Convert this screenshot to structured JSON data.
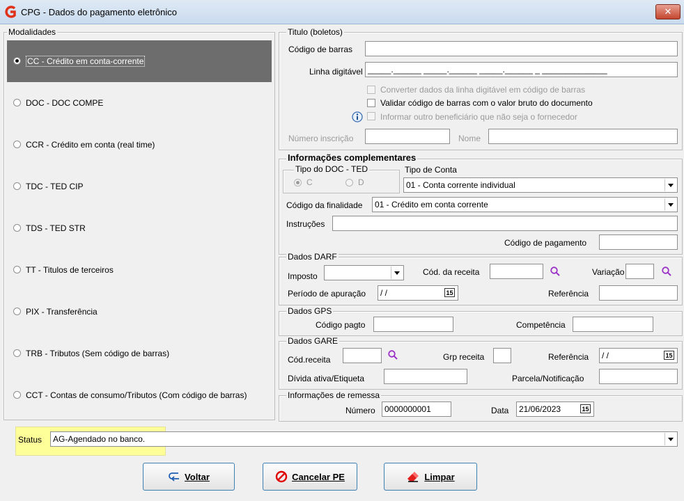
{
  "window": {
    "title": "CPG - Dados do pagamento eletrônico",
    "close_label": "✕"
  },
  "modalidades": {
    "legend": "Modalidades",
    "selected_index": 0,
    "items": [
      "CC  - Crédito em conta-corrente",
      "DOC - DOC COMPE",
      "CCR - Crédito em conta (real time)",
      "TDC - TED CIP",
      "TDS - TED STR",
      "TT  - Titulos de terceiros",
      "PIX - Transferência",
      "TRB - Tributos (Sem código de barras)",
      "CCT - Contas de consumo/Tributos (Com código de barras)"
    ]
  },
  "titulo": {
    "legend": "Titulo (boletos)",
    "codigo_barras_label": "Código de barras",
    "codigo_barras_value": "",
    "linha_digitavel_label": "Linha digitável",
    "linha_digitavel_value": "_____.______ _____.______ _____.______ _ ______________",
    "chk_converter": "Converter dados da linha digitável em código de barras",
    "chk_validar": "Validar código de barras com o valor bruto do documento",
    "chk_informar": "Informar outro beneficiário que não seja o fornecedor",
    "numero_inscricao_label": "Número inscrição",
    "nome_label": "Nome"
  },
  "info_compl": {
    "legend": "Informações complementares",
    "tipo_doc_legend": "Tipo do DOC - TED",
    "radio_c": "C",
    "radio_d": "D",
    "tipo_conta_label": "Tipo de Conta",
    "tipo_conta_value": "01 - Conta corrente individual",
    "finalidade_label": "Código da finalidade",
    "finalidade_value": "01 - Crédito em conta corrente",
    "instrucoes_label": "Instruções",
    "codigo_pagamento_label": "Código de pagamento"
  },
  "darf": {
    "legend": "Dados DARF",
    "imposto_label": "Imposto",
    "cod_receita_label": "Cód. da receita",
    "variacao_label": "Variação",
    "periodo_label": "Período de apuração",
    "periodo_value": " / /",
    "referencia_label": "Referência"
  },
  "gps": {
    "legend": "Dados GPS",
    "codigo_pagto_label": "Código pagto",
    "competencia_label": "Competência"
  },
  "gare": {
    "legend": "Dados GARE",
    "cod_receita_label": "Cód.receita",
    "grp_receita_label": "Grp receita",
    "referencia_label": "Referência",
    "referencia_value": " / /",
    "divida_label": "Dívida ativa/Etiqueta",
    "parcela_label": "Parcela/Notificação"
  },
  "remessa": {
    "legend": "Informações de remessa",
    "numero_label": "Número",
    "numero_value": "0000000001",
    "data_label": "Data",
    "data_value": "21/06/2023"
  },
  "status": {
    "label": "Status",
    "value": "AG-Agendado no banco."
  },
  "buttons": {
    "voltar": "Voltar",
    "cancelar": "Cancelar PE",
    "limpar": "Limpar"
  },
  "calendar_glyph": "15",
  "colors": {
    "highlight": "#ffff99",
    "selected_row": "#6d6d6d",
    "accent_purple": "#9b30c8",
    "logo_red": "#e0321b"
  }
}
